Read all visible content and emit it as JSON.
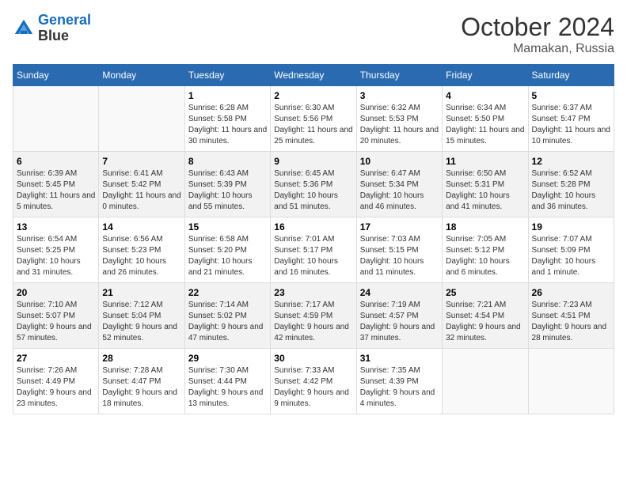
{
  "header": {
    "logo_line1": "General",
    "logo_line2": "Blue",
    "month_title": "October 2024",
    "location": "Mamakan, Russia"
  },
  "weekdays": [
    "Sunday",
    "Monday",
    "Tuesday",
    "Wednesday",
    "Thursday",
    "Friday",
    "Saturday"
  ],
  "weeks": [
    [
      {
        "day": "",
        "sunrise": "",
        "sunset": "",
        "daylight": ""
      },
      {
        "day": "",
        "sunrise": "",
        "sunset": "",
        "daylight": ""
      },
      {
        "day": "1",
        "sunrise": "Sunrise: 6:28 AM",
        "sunset": "Sunset: 5:58 PM",
        "daylight": "Daylight: 11 hours and 30 minutes."
      },
      {
        "day": "2",
        "sunrise": "Sunrise: 6:30 AM",
        "sunset": "Sunset: 5:56 PM",
        "daylight": "Daylight: 11 hours and 25 minutes."
      },
      {
        "day": "3",
        "sunrise": "Sunrise: 6:32 AM",
        "sunset": "Sunset: 5:53 PM",
        "daylight": "Daylight: 11 hours and 20 minutes."
      },
      {
        "day": "4",
        "sunrise": "Sunrise: 6:34 AM",
        "sunset": "Sunset: 5:50 PM",
        "daylight": "Daylight: 11 hours and 15 minutes."
      },
      {
        "day": "5",
        "sunrise": "Sunrise: 6:37 AM",
        "sunset": "Sunset: 5:47 PM",
        "daylight": "Daylight: 11 hours and 10 minutes."
      }
    ],
    [
      {
        "day": "6",
        "sunrise": "Sunrise: 6:39 AM",
        "sunset": "Sunset: 5:45 PM",
        "daylight": "Daylight: 11 hours and 5 minutes."
      },
      {
        "day": "7",
        "sunrise": "Sunrise: 6:41 AM",
        "sunset": "Sunset: 5:42 PM",
        "daylight": "Daylight: 11 hours and 0 minutes."
      },
      {
        "day": "8",
        "sunrise": "Sunrise: 6:43 AM",
        "sunset": "Sunset: 5:39 PM",
        "daylight": "Daylight: 10 hours and 55 minutes."
      },
      {
        "day": "9",
        "sunrise": "Sunrise: 6:45 AM",
        "sunset": "Sunset: 5:36 PM",
        "daylight": "Daylight: 10 hours and 51 minutes."
      },
      {
        "day": "10",
        "sunrise": "Sunrise: 6:47 AM",
        "sunset": "Sunset: 5:34 PM",
        "daylight": "Daylight: 10 hours and 46 minutes."
      },
      {
        "day": "11",
        "sunrise": "Sunrise: 6:50 AM",
        "sunset": "Sunset: 5:31 PM",
        "daylight": "Daylight: 10 hours and 41 minutes."
      },
      {
        "day": "12",
        "sunrise": "Sunrise: 6:52 AM",
        "sunset": "Sunset: 5:28 PM",
        "daylight": "Daylight: 10 hours and 36 minutes."
      }
    ],
    [
      {
        "day": "13",
        "sunrise": "Sunrise: 6:54 AM",
        "sunset": "Sunset: 5:25 PM",
        "daylight": "Daylight: 10 hours and 31 minutes."
      },
      {
        "day": "14",
        "sunrise": "Sunrise: 6:56 AM",
        "sunset": "Sunset: 5:23 PM",
        "daylight": "Daylight: 10 hours and 26 minutes."
      },
      {
        "day": "15",
        "sunrise": "Sunrise: 6:58 AM",
        "sunset": "Sunset: 5:20 PM",
        "daylight": "Daylight: 10 hours and 21 minutes."
      },
      {
        "day": "16",
        "sunrise": "Sunrise: 7:01 AM",
        "sunset": "Sunset: 5:17 PM",
        "daylight": "Daylight: 10 hours and 16 minutes."
      },
      {
        "day": "17",
        "sunrise": "Sunrise: 7:03 AM",
        "sunset": "Sunset: 5:15 PM",
        "daylight": "Daylight: 10 hours and 11 minutes."
      },
      {
        "day": "18",
        "sunrise": "Sunrise: 7:05 AM",
        "sunset": "Sunset: 5:12 PM",
        "daylight": "Daylight: 10 hours and 6 minutes."
      },
      {
        "day": "19",
        "sunrise": "Sunrise: 7:07 AM",
        "sunset": "Sunset: 5:09 PM",
        "daylight": "Daylight: 10 hours and 1 minute."
      }
    ],
    [
      {
        "day": "20",
        "sunrise": "Sunrise: 7:10 AM",
        "sunset": "Sunset: 5:07 PM",
        "daylight": "Daylight: 9 hours and 57 minutes."
      },
      {
        "day": "21",
        "sunrise": "Sunrise: 7:12 AM",
        "sunset": "Sunset: 5:04 PM",
        "daylight": "Daylight: 9 hours and 52 minutes."
      },
      {
        "day": "22",
        "sunrise": "Sunrise: 7:14 AM",
        "sunset": "Sunset: 5:02 PM",
        "daylight": "Daylight: 9 hours and 47 minutes."
      },
      {
        "day": "23",
        "sunrise": "Sunrise: 7:17 AM",
        "sunset": "Sunset: 4:59 PM",
        "daylight": "Daylight: 9 hours and 42 minutes."
      },
      {
        "day": "24",
        "sunrise": "Sunrise: 7:19 AM",
        "sunset": "Sunset: 4:57 PM",
        "daylight": "Daylight: 9 hours and 37 minutes."
      },
      {
        "day": "25",
        "sunrise": "Sunrise: 7:21 AM",
        "sunset": "Sunset: 4:54 PM",
        "daylight": "Daylight: 9 hours and 32 minutes."
      },
      {
        "day": "26",
        "sunrise": "Sunrise: 7:23 AM",
        "sunset": "Sunset: 4:51 PM",
        "daylight": "Daylight: 9 hours and 28 minutes."
      }
    ],
    [
      {
        "day": "27",
        "sunrise": "Sunrise: 7:26 AM",
        "sunset": "Sunset: 4:49 PM",
        "daylight": "Daylight: 9 hours and 23 minutes."
      },
      {
        "day": "28",
        "sunrise": "Sunrise: 7:28 AM",
        "sunset": "Sunset: 4:47 PM",
        "daylight": "Daylight: 9 hours and 18 minutes."
      },
      {
        "day": "29",
        "sunrise": "Sunrise: 7:30 AM",
        "sunset": "Sunset: 4:44 PM",
        "daylight": "Daylight: 9 hours and 13 minutes."
      },
      {
        "day": "30",
        "sunrise": "Sunrise: 7:33 AM",
        "sunset": "Sunset: 4:42 PM",
        "daylight": "Daylight: 9 hours and 9 minutes."
      },
      {
        "day": "31",
        "sunrise": "Sunrise: 7:35 AM",
        "sunset": "Sunset: 4:39 PM",
        "daylight": "Daylight: 9 hours and 4 minutes."
      },
      {
        "day": "",
        "sunrise": "",
        "sunset": "",
        "daylight": ""
      },
      {
        "day": "",
        "sunrise": "",
        "sunset": "",
        "daylight": ""
      }
    ]
  ]
}
